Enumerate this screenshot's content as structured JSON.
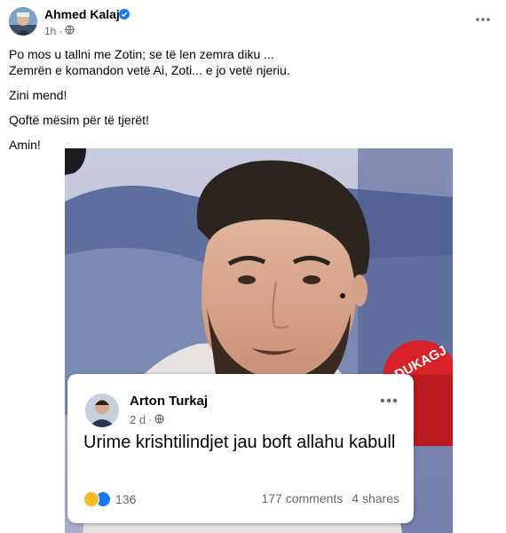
{
  "post": {
    "author": "Ahmed Kalaja",
    "time": "1h",
    "caption": [
      "Po mos u tallni me Zotin; se të len zemra diku ...",
      "Zemrën e komandon vetë Ai,  Zoti... e jo vetë njeriu.",
      "Zini mend!",
      "Qoftë mësim për të tjerët!",
      "Amin!"
    ]
  },
  "card": {
    "author": "Arton Turkaj",
    "time": "2 d",
    "text": "Urime krishtilindjet jau boft allahu kabull",
    "reaction_count": "136",
    "comments": "177 comments",
    "shares": "4 shares"
  },
  "mic_label": "DUKAGJ"
}
